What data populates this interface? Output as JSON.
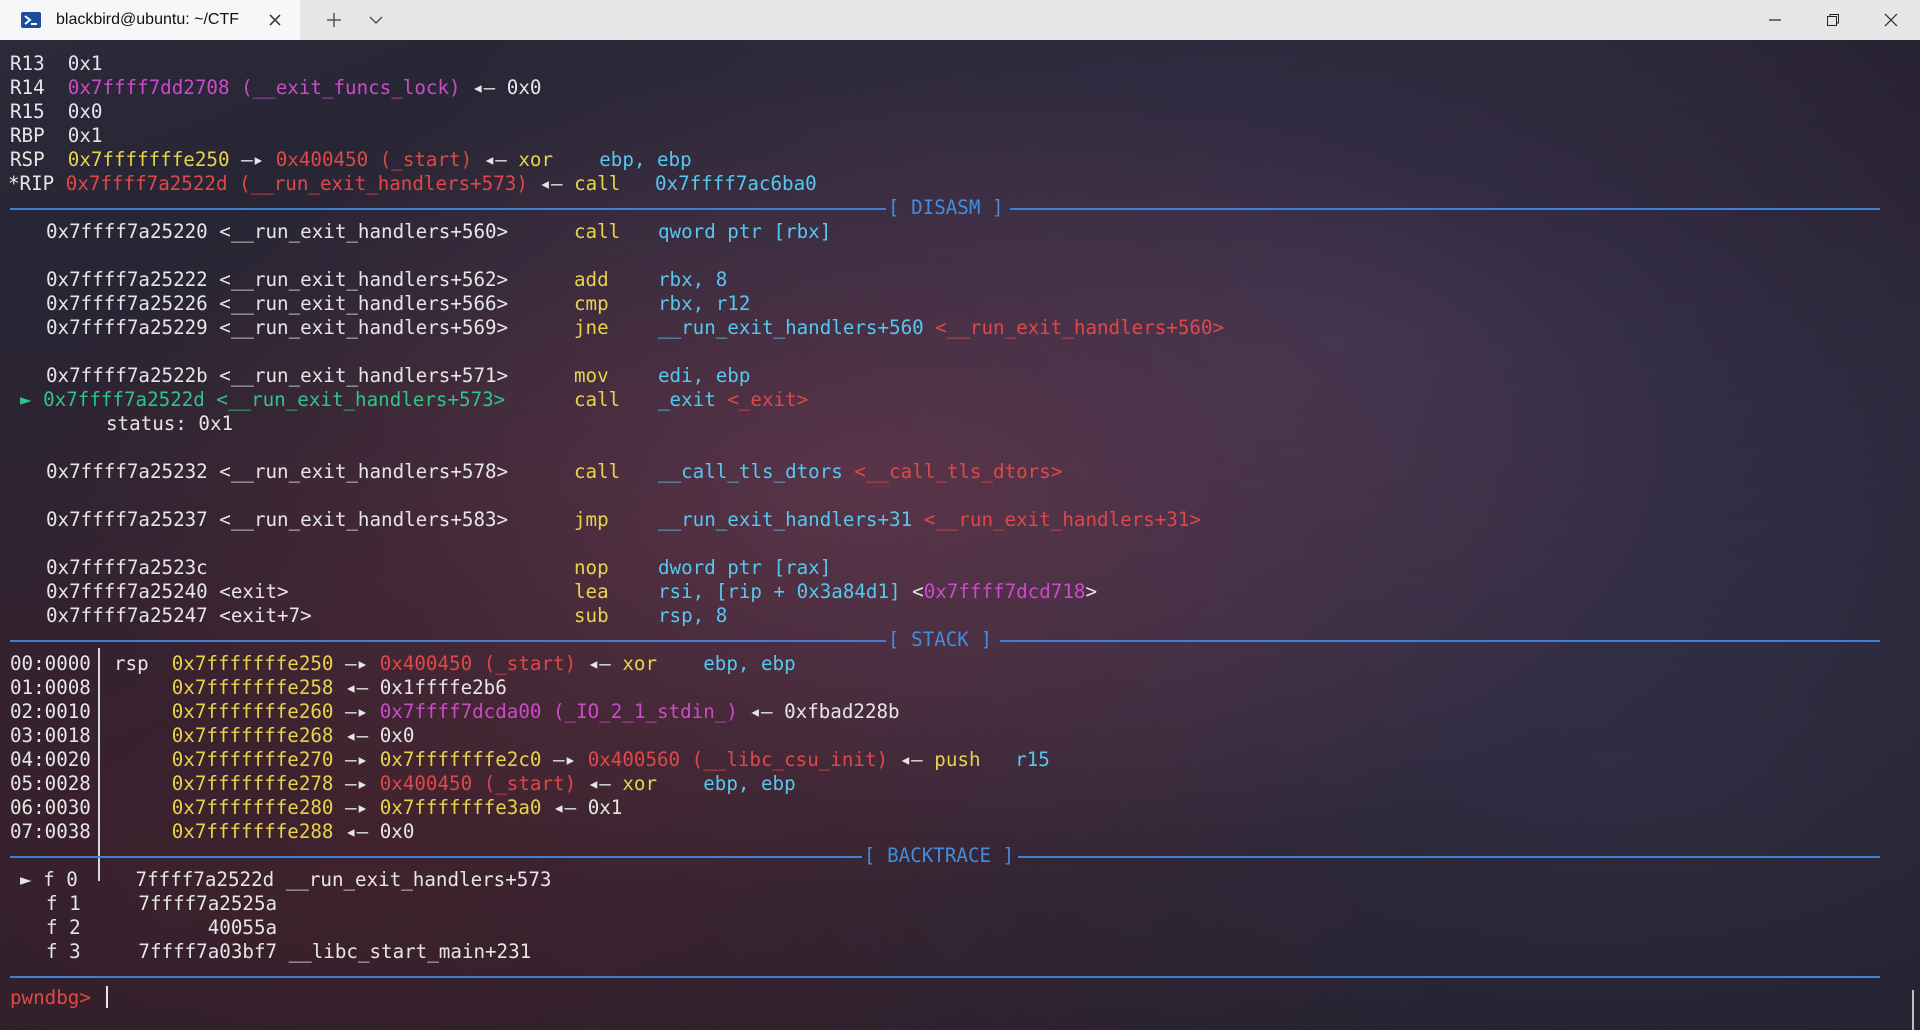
{
  "window": {
    "tab_title": "blackbird@ubuntu: ~/CTF",
    "icons": [
      "terminal-icon",
      "close-icon",
      "plus-icon",
      "chevron-down-icon",
      "minimize-icon",
      "maximize-icon",
      "close-window-icon"
    ]
  },
  "colors": {
    "register_name": "#e6e6e6",
    "stack_address": "#e8d34a",
    "code_address": "#e04848",
    "data_address": "#cc4bc8",
    "operand": "#55c8f0",
    "current_instruction": "#2fc58a",
    "mnemonic": "#e8d34a",
    "section_rule": "#3f7fd6",
    "prompt": "#e04848"
  },
  "registers": [
    {
      "name": "R13",
      "value": "0x1"
    },
    {
      "name": "R14",
      "value": "0x7ffff7dd2708",
      "symbol": "(__exit_funcs_lock)",
      "deref": "0x0"
    },
    {
      "name": "R15",
      "value": "0x0"
    },
    {
      "name": "RBP",
      "value": "0x1"
    },
    {
      "name": "RSP",
      "value": "0x7fffffffe250",
      "arrow": "—▸",
      "target": "0x400450",
      "target_symbol": "(_start)",
      "op": "xor",
      "args": "ebp, ebp"
    },
    {
      "name": "*RIP",
      "value": "0x7ffff7a2522d",
      "symbol": "(__run_exit_handlers+573)",
      "op": "call",
      "args": "0x7ffff7ac6ba0"
    }
  ],
  "sections": {
    "disasm": "[ DISASM ]",
    "stack": "[ STACK ]",
    "backtrace": "[ BACKTRACE ]"
  },
  "disasm": [
    {
      "addr": "0x7ffff7a25220",
      "sym": "<__run_exit_handlers+560>",
      "op": "call",
      "args": "qword ptr [rbx]"
    },
    {
      "addr": "0x7ffff7a25222",
      "sym": "<__run_exit_handlers+562>",
      "op": "add",
      "args": "rbx, 8"
    },
    {
      "addr": "0x7ffff7a25226",
      "sym": "<__run_exit_handlers+566>",
      "op": "cmp",
      "args": "rbx, r12"
    },
    {
      "addr": "0x7ffff7a25229",
      "sym": "<__run_exit_handlers+569>",
      "op": "jne",
      "args": "__run_exit_handlers+560",
      "target": "<__run_exit_handlers+560>"
    },
    {
      "addr": "0x7ffff7a2522b",
      "sym": "<__run_exit_handlers+571>",
      "op": "mov",
      "args": "edi, ebp"
    },
    {
      "marker": "►",
      "addr": "0x7ffff7a2522d",
      "sym": "<__run_exit_handlers+573>",
      "op": "call",
      "args": "_exit",
      "target": "<_exit>"
    },
    {
      "status": "status: 0x1"
    },
    {
      "addr": "0x7ffff7a25232",
      "sym": "<__run_exit_handlers+578>",
      "op": "call",
      "args": "__call_tls_dtors",
      "target": "<__call_tls_dtors>"
    },
    {
      "addr": "0x7ffff7a25237",
      "sym": "<__run_exit_handlers+583>",
      "op": "jmp",
      "args": "__run_exit_handlers+31",
      "target": "<__run_exit_handlers+31>"
    },
    {
      "addr": "0x7ffff7a2523c",
      "sym": "",
      "op": "nop",
      "args": "dword ptr [rax]"
    },
    {
      "addr": "0x7ffff7a25240",
      "sym": "<exit>",
      "op": "lea",
      "args": "rsi, [rip + 0x3a84d1]",
      "target": "0x7ffff7dcd718"
    },
    {
      "addr": "0x7ffff7a25247",
      "sym": "<exit+7>",
      "op": "sub",
      "args": "rsp, 8"
    }
  ],
  "stack": [
    {
      "off": "00:0000",
      "reg": "rsp",
      "addr": "0x7fffffffe250",
      "arrow": "—▸",
      "val": "0x400450",
      "val_sym": "(_start)",
      "tail_arrow": "◂—",
      "tail": "xor",
      "tail_args": "ebp, ebp"
    },
    {
      "off": "01:0008",
      "addr": "0x7fffffffe258",
      "arrow": "◂—",
      "val": "0x1ffffe2b6"
    },
    {
      "off": "02:0010",
      "addr": "0x7fffffffe260",
      "arrow": "—▸",
      "val": "0x7ffff7dcda00",
      "val_sym": "(_IO_2_1_stdin_)",
      "tail_arrow": "◂—",
      "tail": "0xfbad228b"
    },
    {
      "off": "03:0018",
      "addr": "0x7fffffffe268",
      "arrow": "◂—",
      "val": "0x0"
    },
    {
      "off": "04:0020",
      "addr": "0x7fffffffe270",
      "arrow": "—▸",
      "val": "0x7fffffffe2c0",
      "arrow2": "—▸",
      "val2": "0x400560",
      "val2_sym": "(__libc_csu_init)",
      "tail_arrow": "◂—",
      "tail": "push",
      "tail_args": "r15"
    },
    {
      "off": "05:0028",
      "addr": "0x7fffffffe278",
      "arrow": "—▸",
      "val": "0x400450",
      "val_sym": "(_start)",
      "tail_arrow": "◂—",
      "tail": "xor",
      "tail_args": "ebp, ebp"
    },
    {
      "off": "06:0030",
      "addr": "0x7fffffffe280",
      "arrow": "—▸",
      "val": "0x7fffffffe3a0",
      "tail_arrow": "◂—",
      "tail": "0x1"
    },
    {
      "off": "07:0038",
      "addr": "0x7fffffffe288",
      "arrow": "◂—",
      "val": "0x0"
    }
  ],
  "backtrace": [
    {
      "marker": "►",
      "frame": "f 0",
      "addr": "7ffff7a2522d",
      "sym": "__run_exit_handlers+573"
    },
    {
      "frame": "f 1",
      "addr": "7ffff7a2525a",
      "sym": ""
    },
    {
      "frame": "f 2",
      "addr": "40055a",
      "sym": ""
    },
    {
      "frame": "f 3",
      "addr": "7ffff7a03bf7",
      "sym": "__libc_start_main+231"
    }
  ],
  "prompt": "pwndbg>"
}
